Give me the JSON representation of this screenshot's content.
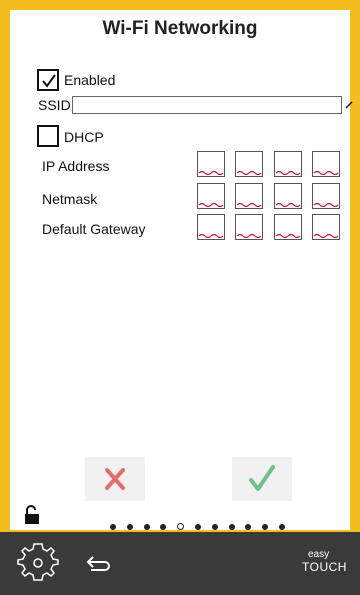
{
  "title": "Wi-Fi Networking",
  "enabled": {
    "label": "Enabled",
    "checked": true
  },
  "ssid": {
    "label": "SSID",
    "value": ""
  },
  "dhcp": {
    "label": "DHCP",
    "checked": false
  },
  "ip": {
    "label": "IP Address",
    "octets": [
      "",
      "",
      "",
      ""
    ]
  },
  "netmask": {
    "label": "Netmask",
    "octets": [
      "",
      "",
      "",
      ""
    ]
  },
  "gateway": {
    "label": "Default Gateway",
    "octets": [
      "",
      "",
      "",
      ""
    ]
  },
  "actions": {
    "cancel_icon": "x-icon",
    "confirm_icon": "check-icon"
  },
  "pager": {
    "total": 11,
    "current": 5
  },
  "bottombar": {
    "brand_top": "easy",
    "brand_bottom": "TOUCH"
  },
  "colors": {
    "frame": "#f2bd1d",
    "cancel": "#e76b6b",
    "confirm": "#6cc08a",
    "bar": "#3a3a3a"
  }
}
